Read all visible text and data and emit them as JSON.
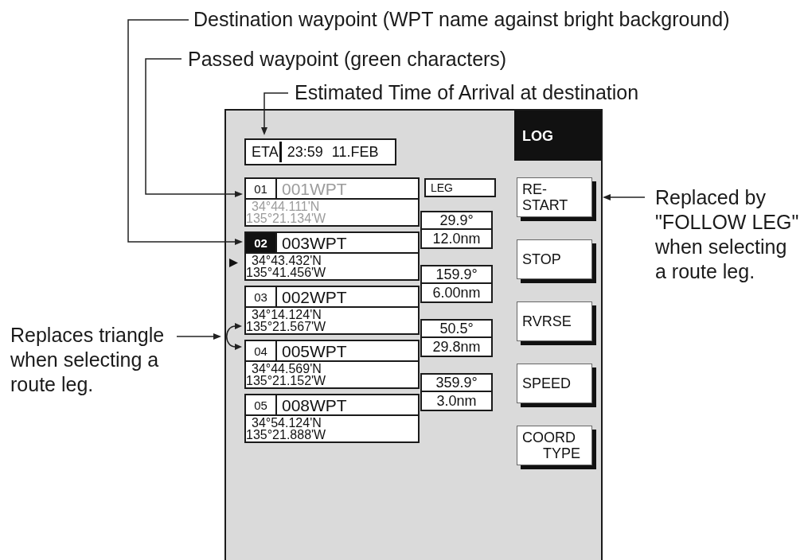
{
  "callouts": [
    {
      "lines": [
        "Destination waypoint (WPT name against bright background)"
      ]
    },
    {
      "lines": [
        "Passed waypoint (green characters)"
      ]
    },
    {
      "lines": [
        "Estimated Time of Arrival at destination"
      ]
    },
    {
      "lines": [
        "Replaced by",
        "\"FOLLOW LEG\"",
        "when selecting",
        "a route leg."
      ]
    },
    {
      "lines": [
        "Replaces triangle",
        "when selecting a",
        "route leg."
      ]
    }
  ],
  "screen": {
    "eta": {
      "label": "ETA",
      "time": "23:59",
      "date": "11.FEB"
    },
    "waypoints": [
      {
        "number": "01",
        "name": "001WPT",
        "latitude": "34°44.111'N",
        "longitude": "135°21.134'W",
        "passed": true,
        "destination": false,
        "current": false
      },
      {
        "number": "02",
        "name": "003WPT",
        "latitude": "34°43.432'N",
        "longitude": "135°41.456'W",
        "passed": false,
        "destination": true,
        "current": true
      },
      {
        "number": "03",
        "name": "002WPT",
        "latitude": "34°14.124'N",
        "longitude": "135°21.567'W",
        "passed": false,
        "destination": false,
        "current": false
      },
      {
        "number": "04",
        "name": "005WPT",
        "latitude": "34°44.569'N",
        "longitude": "135°21.152'W",
        "passed": false,
        "destination": false,
        "current": false
      },
      {
        "number": "05",
        "name": "008WPT",
        "latitude": "34°54.124'N",
        "longitude": "135°21.888'W",
        "passed": false,
        "destination": false,
        "current": false
      }
    ],
    "leg_header": "LEG",
    "legs": [
      {
        "bearing": "29.9°",
        "distance": "12.0nm"
      },
      {
        "bearing": "159.9°",
        "distance": "6.00nm"
      },
      {
        "bearing": "50.5°",
        "distance": "29.8nm"
      },
      {
        "bearing": "359.9°",
        "distance": "3.0nm"
      }
    ],
    "menu": {
      "title": "LOG",
      "buttons": [
        {
          "lines": [
            {
              "text": "RE-",
              "indent": false
            },
            {
              "text": "START",
              "indent": false
            }
          ]
        },
        {
          "lines": [
            {
              "text": "STOP",
              "indent": false
            }
          ]
        },
        {
          "lines": [
            {
              "text": "RVRSE",
              "indent": false
            }
          ]
        },
        {
          "lines": [
            {
              "text": "SPEED",
              "indent": false
            }
          ]
        },
        {
          "lines": [
            {
              "text": "COORD",
              "indent": false
            },
            {
              "text": "TYPE",
              "indent": true
            }
          ]
        }
      ]
    }
  }
}
